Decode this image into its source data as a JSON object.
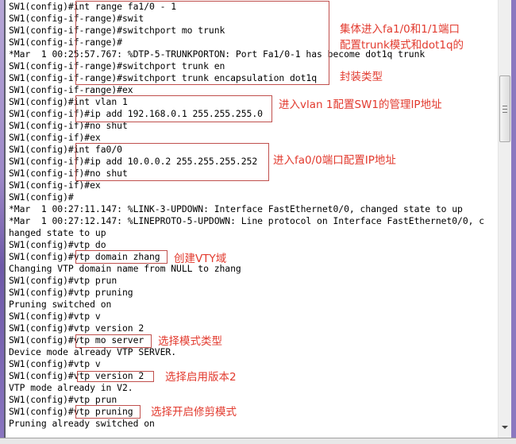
{
  "terminal": {
    "lines": [
      "SW1(config)#int range fa1/0 - 1",
      "SW1(config-if-range)#swit",
      "SW1(config-if-range)#switchport mo trunk",
      "SW1(config-if-range)#",
      "*Mar  1 00:25:57.767: %DTP-5-TRUNKPORTON: Port Fa1/0-1 has become dot1q trunk",
      "SW1(config-if-range)#switchport trunk en",
      "SW1(config-if-range)#switchport trunk encapsulation dot1q",
      "SW1(config-if-range)#ex",
      "SW1(config)#int vlan 1",
      "SW1(config-if)#ip add 192.168.0.1 255.255.255.0",
      "SW1(config-if)#no shut",
      "SW1(config-if)#ex",
      "SW1(config)#int fa0/0",
      "SW1(config-if)#ip add 10.0.0.2 255.255.255.252",
      "SW1(config-if)#no shut",
      "SW1(config-if)#ex",
      "SW1(config)#",
      "*Mar  1 00:27:11.147: %LINK-3-UPDOWN: Interface FastEthernet0/0, changed state to up",
      "*Mar  1 00:27:12.147: %LINEPROTO-5-UPDOWN: Line protocol on Interface FastEthernet0/0, c",
      "hanged state to up",
      "SW1(config)#vtp do",
      "SW1(config)#vtp domain zhang",
      "Changing VTP domain name from NULL to zhang",
      "SW1(config)#vtp prun",
      "SW1(config)#vtp pruning",
      "Pruning switched on",
      "SW1(config)#vtp v",
      "SW1(config)#vtp version 2",
      "SW1(config)#vtp mo server",
      "Device mode already VTP SERVER.",
      "SW1(config)#vtp v",
      "SW1(config)#vtp version 2",
      "VTP mode already in V2.",
      "SW1(config)#vtp prun",
      "SW1(config)#vtp pruning",
      "Pruning already switched on"
    ]
  },
  "annotations": {
    "trunk_note": "集体进入fa1/0和1/1端口\n配置trunk模式和dot1q的\n\n封装类型",
    "vlan_note": "进入vlan 1配置SW1的管理IP地址",
    "fa00_note": "进入fa0/0端口配置IP地址",
    "vtp_domain_note": "创建VTY域",
    "vtp_mode_note": "选择模式类型",
    "vtp_version_note": "选择启用版本2",
    "vtp_pruning_note": "选择开启修剪模式"
  },
  "colors": {
    "annotation_text": "#e23a2e",
    "annotation_box": "#c0504d",
    "window_border": "#8b78c0"
  }
}
